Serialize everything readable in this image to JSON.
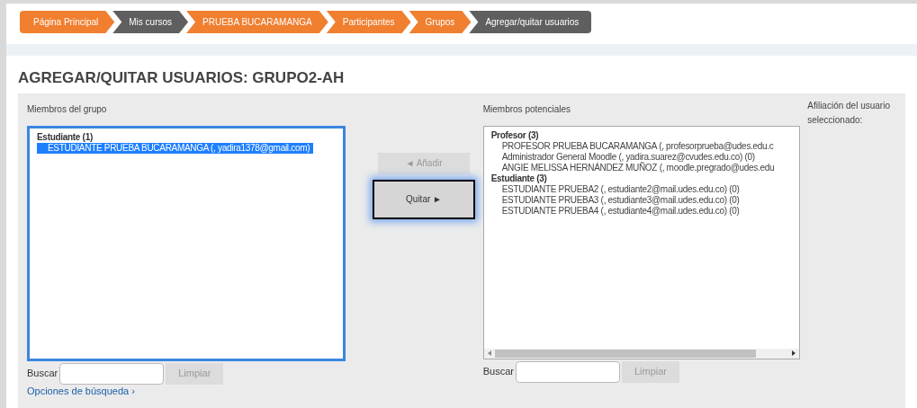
{
  "breadcrumb": [
    {
      "label": "Página Principal",
      "color": "#f07f30"
    },
    {
      "label": "Mis cursos",
      "color": "#5f5f5f"
    },
    {
      "label": "PRUEBA BUCARAMANGA",
      "color": "#f07f30"
    },
    {
      "label": "Participantes",
      "color": "#f07f30"
    },
    {
      "label": "Grupos",
      "color": "#f07f30"
    },
    {
      "label": "Agregar/quitar usuarios",
      "color": "#5f5f5f"
    }
  ],
  "heading": "AGREGAR/QUITAR USUARIOS: GRUPO2-AH",
  "group_members": {
    "label": "Miembros del grupo",
    "groups": [
      {
        "label": "Estudiante (1)",
        "items": [
          {
            "label": "ESTUDIANTE PRUEBA BUCARAMANGA (, yadira1378@gmail.com)",
            "selected": true
          }
        ]
      }
    ],
    "search_label": "Buscar",
    "clear_button": {
      "label": "Limpiar",
      "disabled": true
    }
  },
  "buttons": [
    {
      "label": "◄ Añadir",
      "disabled": true,
      "focused": false
    },
    {
      "label": "Quitar ►",
      "disabled": false,
      "focused": true
    }
  ],
  "potential_members": {
    "label": "Miembros potenciales",
    "groups": [
      {
        "label": "Profesor (3)",
        "items": [
          {
            "label": "PROFESOR PRUEBA BUCARAMANGA (, profesorprueba@udes.edu.c",
            "selected": false
          },
          {
            "label": "Administrador General Moodle (, yadira.suarez@cvudes.edu.co) (0)",
            "selected": false
          },
          {
            "label": "ANGIE MELISSA HERNÁNDEZ MUÑOZ (, moodle.pregrado@udes.edu",
            "selected": false
          }
        ]
      },
      {
        "label": "Estudiante (3)",
        "items": [
          {
            "label": "ESTUDIANTE PRUEBA2 (, estudiante2@mail.udes.edu.co) (0)",
            "selected": false
          },
          {
            "label": "ESTUDIANTE PRUEBA3 (, estudiante3@mail.udes.edu.co) (0)",
            "selected": false
          },
          {
            "label": "ESTUDIANTE PRUEBA4 (, estudiante4@mail.udes.edu.co) (0)",
            "selected": false
          }
        ]
      }
    ],
    "search_label": "Buscar",
    "clear_button": {
      "label": "Limpiar",
      "disabled": true
    }
  },
  "affiliation_label": "Afiliación del usuario seleccionado:",
  "search_options_link": "Opciones de búsqueda ›"
}
